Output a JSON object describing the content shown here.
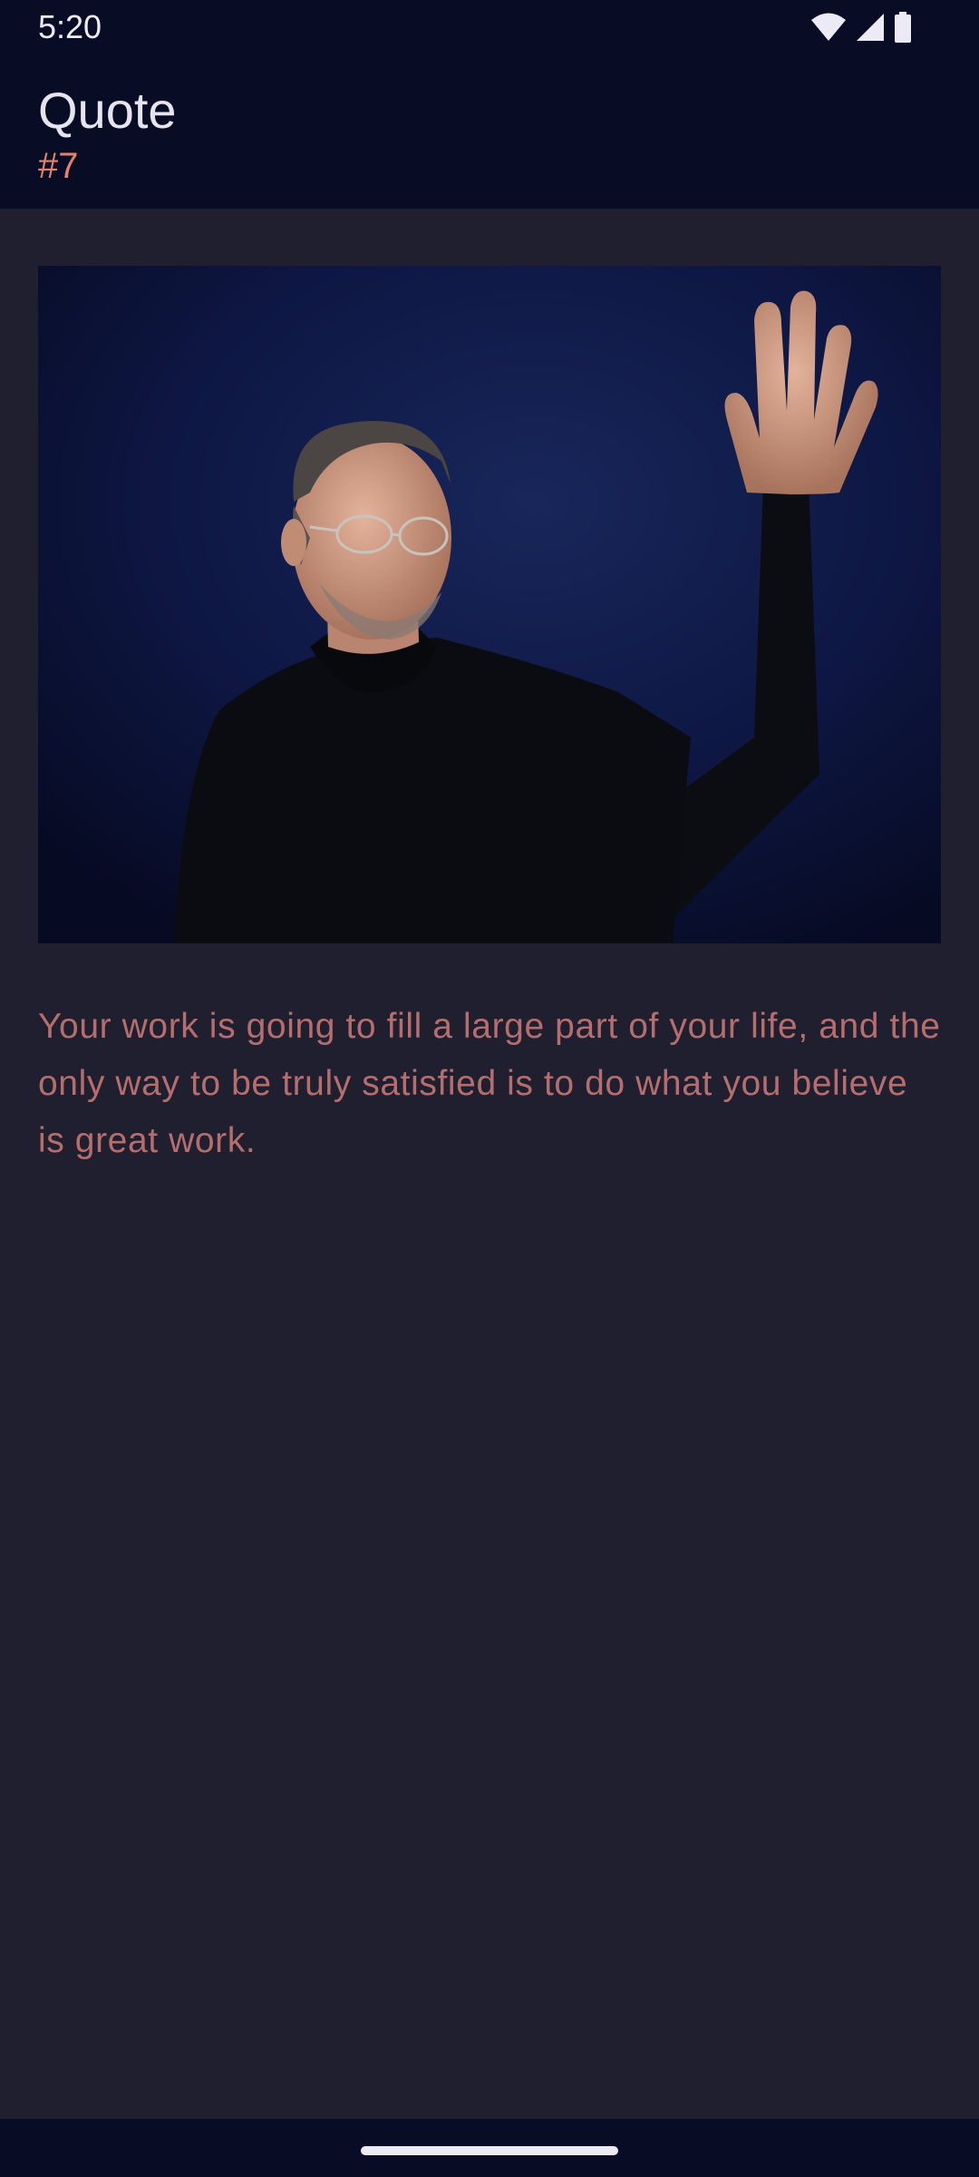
{
  "status_bar": {
    "time": "5:20",
    "icons": [
      "wifi-icon",
      "cellular-signal-icon",
      "battery-icon"
    ]
  },
  "app_bar": {
    "title": "Quote",
    "subtitle": "#7"
  },
  "quote": {
    "text": "Your work is going to fill a large part of your life, and the only way to be truly satisfied is to do what you believe is great work."
  },
  "colors": {
    "background": "#201f2f",
    "bar": "#080d25",
    "accent": "#e5826d",
    "quote_text": "#b56e6d"
  }
}
